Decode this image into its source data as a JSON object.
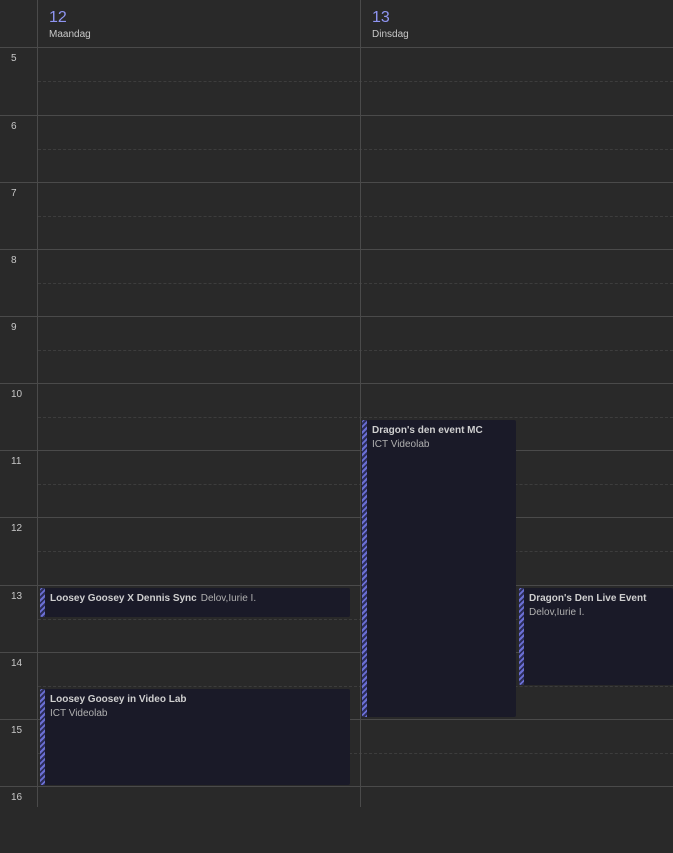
{
  "days": [
    {
      "number": "12",
      "name": "Maandag"
    },
    {
      "number": "13",
      "name": "Dinsdag"
    }
  ],
  "hours": [
    "5",
    "6",
    "7",
    "8",
    "9",
    "10",
    "11",
    "12",
    "13",
    "14",
    "15",
    "16"
  ],
  "events": [
    {
      "title": "Dragon's den event MC",
      "subtitle": "ICT Videolab"
    },
    {
      "title": "Loosey Goosey X Dennis Sync",
      "subtitle": "Delov,Iurie I."
    },
    {
      "title": "Dragon's Den Live Event",
      "subtitle": "Delov,Iurie I."
    },
    {
      "title": "Loosey Goosey in Video Lab",
      "subtitle": "ICT Videolab"
    }
  ],
  "colors": {
    "background": "#292929",
    "accent": "#8f95f2",
    "event_bg": "#1a1a28",
    "event_stripe": "#6b6fd4"
  }
}
